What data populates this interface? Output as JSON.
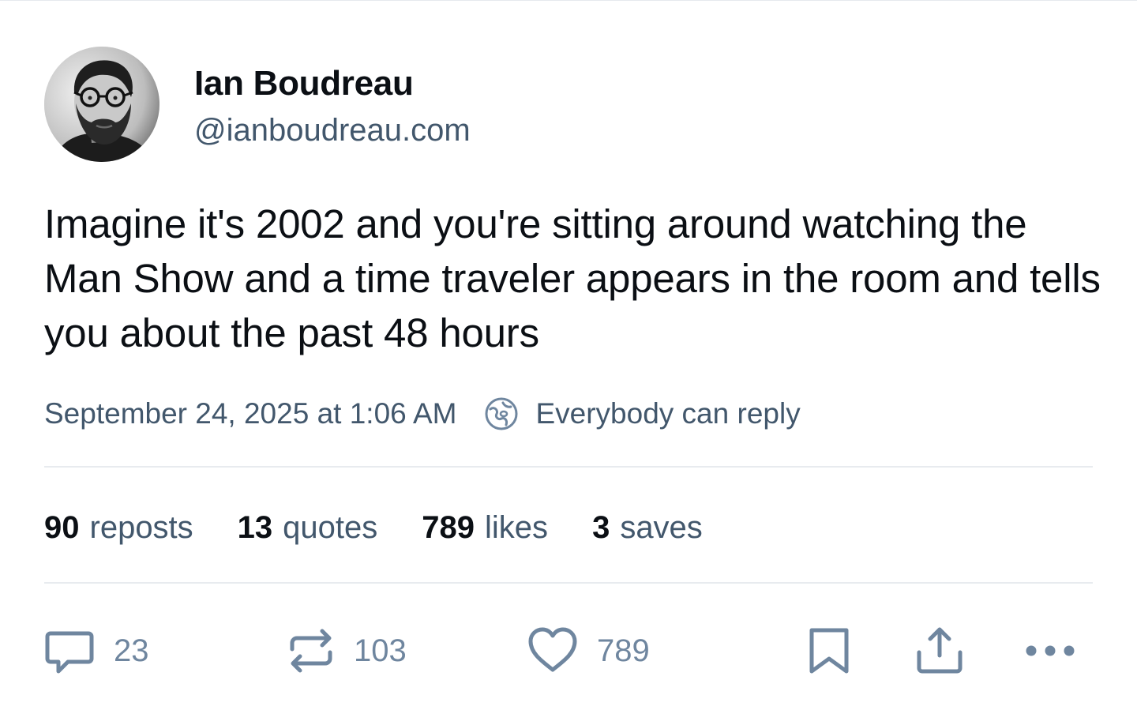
{
  "author": {
    "display_name": "Ian Boudreau",
    "handle": "@ianboudreau.com",
    "avatar_icon": "user-avatar-photo"
  },
  "post": {
    "text": "Imagine it's 2002 and you're sitting around watching the Man Show and a time traveler appears in the room and tells you about the past 48 hours",
    "timestamp": "September 24, 2025 at 1:06 AM",
    "reply_setting": "Everybody can reply",
    "reply_setting_icon": "globe-icon"
  },
  "stats": {
    "reposts": {
      "count": "90",
      "label": "reposts"
    },
    "quotes": {
      "count": "13",
      "label": "quotes"
    },
    "likes": {
      "count": "789",
      "label": "likes"
    },
    "saves": {
      "count": "3",
      "label": "saves"
    }
  },
  "actions": {
    "reply": {
      "icon": "speech-bubble-icon",
      "count": "23"
    },
    "repost": {
      "icon": "repost-arrows-icon",
      "count": "103"
    },
    "like": {
      "icon": "heart-icon",
      "count": "789"
    },
    "save": {
      "icon": "bookmark-icon"
    },
    "share": {
      "icon": "share-icon"
    },
    "more": {
      "icon": "ellipsis-icon"
    }
  },
  "colors": {
    "text_primary": "#0b0f14",
    "text_secondary": "#42576c",
    "icon_muted": "#6f869f",
    "divider": "#e8ebef"
  }
}
